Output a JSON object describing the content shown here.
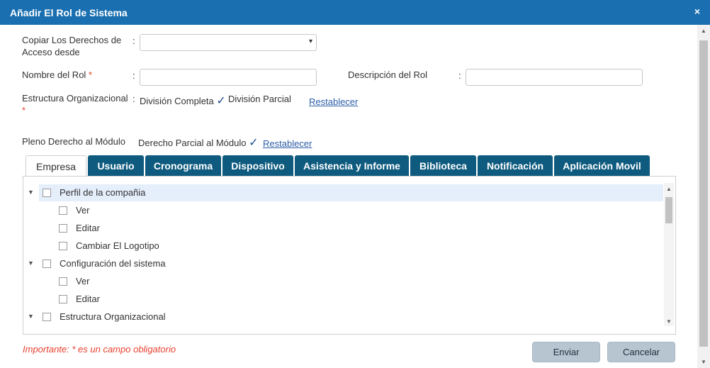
{
  "dialog": {
    "title": "Añadir El Rol de Sistema",
    "close_glyph": "×"
  },
  "form": {
    "copy_rights": {
      "label_line1": "Copiar Los Derechos de",
      "label_line2": "Acceso desde",
      "colon": ":",
      "value": "",
      "caret": "▾"
    },
    "role_name": {
      "label": "Nombre del Rol",
      "required_mark": "*",
      "colon": ":",
      "value": "",
      "placeholder": ""
    },
    "description": {
      "label": "Descripción del Rol",
      "colon": ":",
      "value": "",
      "placeholder": ""
    },
    "org_structure": {
      "label": "Estructura Organizacional",
      "required_mark": "*",
      "colon": ":",
      "option_full": "División Completa",
      "option_full_selected_mark": "✓",
      "option_partial": "División Parcial",
      "reset_link": "Restablecer"
    },
    "module_rights": {
      "full_label": "Pleno Derecho al Módulo",
      "partial_label": "Derecho Parcial al Módulo",
      "partial_selected_mark": "✓",
      "reset_link": "Restablecer"
    }
  },
  "tabs": [
    {
      "label": "Empresa",
      "active": true
    },
    {
      "label": "Usuario",
      "active": false
    },
    {
      "label": "Cronograma",
      "active": false
    },
    {
      "label": "Dispositivo",
      "active": false
    },
    {
      "label": "Asistencia y Informe",
      "active": false
    },
    {
      "label": "Biblioteca",
      "active": false
    },
    {
      "label": "Notificación",
      "active": false
    },
    {
      "label": "Aplicación Movil",
      "active": false
    }
  ],
  "tree": [
    {
      "label": "Perfil de la compañia",
      "level": 0,
      "expanded": true,
      "selected": true,
      "expander": "▼"
    },
    {
      "label": "Ver",
      "level": 1
    },
    {
      "label": "Editar",
      "level": 1
    },
    {
      "label": "Cambiar El Logotipo",
      "level": 1
    },
    {
      "label": "Configuración del sistema",
      "level": 0,
      "expanded": true,
      "expander": "▼"
    },
    {
      "label": "Ver",
      "level": 1
    },
    {
      "label": "Editar",
      "level": 1
    },
    {
      "label": "Estructura Organizacional",
      "level": 0,
      "expanded": true,
      "expander": "▼"
    }
  ],
  "scroll_arrows": {
    "up": "▲",
    "down": "▼"
  },
  "footer": {
    "important_note": "Importante: * es un campo obligatorio",
    "submit_label": "Enviar",
    "cancel_label": "Cancelar"
  },
  "colors": {
    "titlebar": "#1a6fb0",
    "tab_bg": "#0e5b7f",
    "required": "#e8412f",
    "link": "#2b5da8",
    "button_bg": "#b7c5d1"
  }
}
